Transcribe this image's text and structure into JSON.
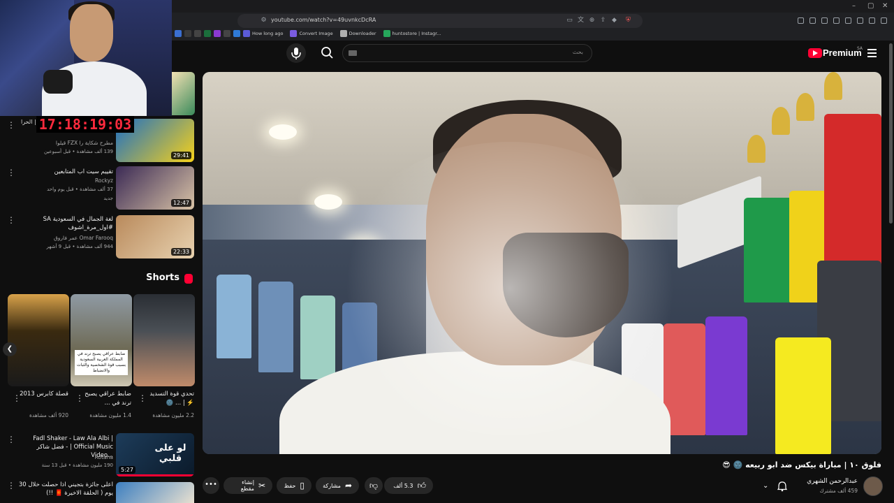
{
  "browser": {
    "url": "youtube.com/watch?v=49uvnkcDcRA",
    "bookmarks": [
      "How long ago",
      "Convert Image",
      "Downloader",
      "huntostore | Instagr..."
    ],
    "window_controls": [
      "–",
      "▢",
      "✕"
    ]
  },
  "stream_overlay": {
    "timer": "17:18:19:03"
  },
  "masthead": {
    "search_placeholder": "بحث",
    "brand": "Premium",
    "region": "SA"
  },
  "sidebar": {
    "cropped_label": "| الحرا",
    "recommendations": [
      {
        "title": "...فقي",
        "channel": "مطرح شكاية را FZX قيلوا",
        "stats": "139 ألف مشاهدة • قبل أسبوعين",
        "duration": "29:41",
        "thumb_colors": [
          "#1d6fc4",
          "#f6d11a"
        ]
      },
      {
        "title": "تقييم سيت اب المتابعين",
        "channel": "Rockyz",
        "stats": "37 ألف مشاهدة • قبل يوم واحد",
        "badge": "جديد",
        "duration": "12:47",
        "thumb_colors": [
          "#3b2a55",
          "#d9c3a6"
        ]
      },
      {
        "title": "لغة الجمال في السعودية SA #اول_مرة_اشوف",
        "channel": "Omar Farooq عمر فاروق",
        "stats": "944 ألف مشاهدة • قبل 9 أشهر",
        "duration": "22:33",
        "thumb_colors": [
          "#b98a5c",
          "#e8d2b0"
        ]
      }
    ],
    "shorts_title": "Shorts",
    "shorts": [
      {
        "title": "تحدي قوة التسديد ⚡️ | ... 🌚",
        "views": "2.2 مليون مشاهدة",
        "thumb_colors": [
          "#2a2e34",
          "#c08b6a"
        ]
      },
      {
        "title": "ضابط عراقي يصبح ترند في ...",
        "views": "1.4 مليون مشاهدة",
        "caption": "ضابط عراقي يصبح ترند في المملكة العربية السعودية بسبب قوة الشخصية والثبات والانضباط",
        "thumb_colors": [
          "#8f9aa4",
          "#6e6a55"
        ]
      },
      {
        "title": "قصلة كابرس 2013",
        "views": "920 ألف مشاهدة",
        "thumb_colors": [
          "#d8a24a",
          "#1a1a1a"
        ]
      }
    ],
    "more_recommendations": [
      {
        "title": "Fadl Shaker - Law Ala Albi | فضل شاكر - | Official Music Video...",
        "channel": "Rotana",
        "stats": "190 مليون مشاهدة • قبل 13 سنة",
        "duration": "5:27",
        "thumb_text": "لو على قلبي",
        "thumb_colors": [
          "#1d3c5a",
          "#0b1a2a"
        ]
      },
      {
        "title": "اعلى جائزة بتجيني اذا حصلت خلال 30 يوم ( الحلقة الاخيرة 🧧 !!)",
        "channel": "",
        "stats": "",
        "thumb_colors": [
          "#3d7fc0",
          "#e8e0d0"
        ]
      }
    ]
  },
  "video": {
    "title": "فلوق ١٠ | مباراة بيكس ضد ابو ربيعه 🌚 😎",
    "channel": "عبدالرحمن الشهري",
    "subscribers": "459 ألف مشترك",
    "likes": "5.3 ألف",
    "actions": {
      "share": "مشاركة",
      "save": "حفظ",
      "clip": "إنشاء مقطع"
    }
  },
  "colors": {
    "accent": "#ff0033",
    "timer": "#ff2a3d",
    "background": "#0f0f0f"
  }
}
